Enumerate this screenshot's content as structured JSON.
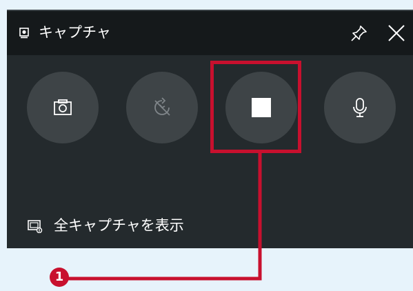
{
  "window": {
    "title": "キャプチャ",
    "title_icon": "webcam-icon",
    "pin_icon": "pin-icon",
    "close_icon": "close-icon"
  },
  "buttons": [
    {
      "name": "screenshot",
      "icon": "camera-icon",
      "enabled": true
    },
    {
      "name": "record-last-30s",
      "icon": "replay-disabled-icon",
      "enabled": false
    },
    {
      "name": "stop-recording",
      "icon": "stop-icon",
      "enabled": true
    },
    {
      "name": "microphone",
      "icon": "microphone-icon",
      "enabled": true
    }
  ],
  "gallery": {
    "label": "全キャプチャを表示",
    "icon": "gallery-icon"
  },
  "callout": {
    "number": "1",
    "color": "#c8102e"
  },
  "colors": {
    "panel": "#242a2d",
    "titlebar": "#15191b",
    "button": "#3e4447",
    "background": "#e7f3fb"
  }
}
